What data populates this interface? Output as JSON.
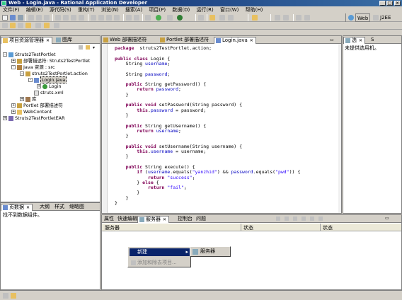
{
  "window": {
    "title": "Web - Login.java - Rational Application Developer"
  },
  "menu": [
    "文件(F)",
    "编辑(E)",
    "源代码(S)",
    "重构(T)",
    "浏览(N)",
    "搜索(A)",
    "项目(P)",
    "数据(D)",
    "运行(R)",
    "窗口(W)",
    "帮助(H)"
  ],
  "perspectives": {
    "web": "Web",
    "j2ee": "J2EE"
  },
  "explorer": {
    "tabs": [
      "项目资源管理器",
      "图库"
    ],
    "tree": [
      "Struts2TestPortlet",
      "部署描述符: Struts2TestPortlet",
      "Java 资源 : src",
      "struts2TestPortlet.action",
      "Login.java",
      "Login",
      "struts.xml",
      "库",
      "Portlet 部署描述符",
      "WebContent",
      "Struts2TestPortletEAR"
    ]
  },
  "editor": {
    "tabs": [
      "Web 部署描述符",
      "Portlet 部署描述符",
      "Login.java"
    ],
    "lines": [
      [
        [
          "kw",
          "package"
        ],
        [
          "",
          "  struts2TestPortlet.action;"
        ]
      ],
      [],
      [
        [
          "kw",
          "public"
        ],
        [
          "",
          ""
        ],
        [
          "kw",
          " class"
        ],
        [
          "",
          " Login {"
        ]
      ],
      [
        [
          "",
          "    String "
        ],
        [
          "fld",
          "username"
        ],
        [
          "",
          ";"
        ]
      ],
      [],
      [
        [
          "",
          "    String "
        ],
        [
          "fld",
          "password"
        ],
        [
          "",
          ";"
        ]
      ],
      [],
      [
        [
          "kw",
          "    public"
        ],
        [
          "",
          " String getPassword() {"
        ]
      ],
      [
        [
          "kw",
          "        return"
        ],
        [
          "",
          " "
        ],
        [
          "fld",
          "password"
        ],
        [
          "",
          ";"
        ]
      ],
      [
        [
          "",
          "    }"
        ]
      ],
      [],
      [
        [
          "kw",
          "    public"
        ],
        [
          "kw",
          " void"
        ],
        [
          "",
          " setPassword(String password) {"
        ]
      ],
      [
        [
          "kw",
          "        this"
        ],
        [
          "",
          "."
        ],
        [
          "fld",
          "password"
        ],
        [
          "",
          " = password;"
        ]
      ],
      [
        [
          "",
          "    }"
        ]
      ],
      [],
      [
        [
          "kw",
          "    public"
        ],
        [
          "",
          " String getUsername() {"
        ]
      ],
      [
        [
          "kw",
          "        return"
        ],
        [
          "",
          " "
        ],
        [
          "fld",
          "username"
        ],
        [
          "",
          ";"
        ]
      ],
      [
        [
          "",
          "    }"
        ]
      ],
      [],
      [
        [
          "kw",
          "    public"
        ],
        [
          "kw",
          " void"
        ],
        [
          "",
          " setUsername(String username) {"
        ]
      ],
      [
        [
          "kw",
          "        this"
        ],
        [
          "",
          "."
        ],
        [
          "fld",
          "username"
        ],
        [
          "",
          " = username;"
        ]
      ],
      [
        [
          "",
          "    }"
        ]
      ],
      [],
      [
        [
          "kw",
          "    public"
        ],
        [
          "",
          " String execute() {"
        ]
      ],
      [
        [
          "kw",
          "        if"
        ],
        [
          "",
          " ("
        ],
        [
          "fld",
          "username"
        ],
        [
          "",
          ".equals("
        ],
        [
          "str",
          "\"yanzhid\""
        ],
        [
          "",
          ") && "
        ],
        [
          "fld",
          "password"
        ],
        [
          "",
          ".equals("
        ],
        [
          "str",
          "\"pwd\""
        ],
        [
          "",
          ")) {"
        ]
      ],
      [
        [
          "kw",
          "            return"
        ],
        [
          "",
          " "
        ],
        [
          "str",
          "\"success\""
        ],
        [
          "",
          ";"
        ]
      ],
      [
        [
          "",
          "        } "
        ],
        [
          "kw",
          "else"
        ],
        [
          "",
          " {"
        ]
      ],
      [
        [
          "kw",
          "            return"
        ],
        [
          "",
          " "
        ],
        [
          "str",
          "\"fail\""
        ],
        [
          "",
          ";"
        ]
      ],
      [
        [
          "",
          "        }"
        ]
      ],
      [
        [
          "",
          "    }"
        ]
      ],
      [
        [
          "",
          "}"
        ]
      ]
    ]
  },
  "outline": {
    "tabs": [
      "选",
      "S"
    ],
    "message": "未提供选用机。"
  },
  "datapage": {
    "tabs": [
      "页数据",
      "大纲",
      "样式",
      "缩略图"
    ],
    "message": "找不到数据组件。"
  },
  "bottom": {
    "tabs": [
      "属性",
      "快速编辑",
      "服务器",
      "控制台",
      "问题"
    ],
    "columns": [
      "服务器",
      "状态",
      "状态"
    ]
  },
  "context_menu": {
    "new_label": "新建",
    "add_label": "添加和除去项目...",
    "submenu_label": "服务器"
  }
}
